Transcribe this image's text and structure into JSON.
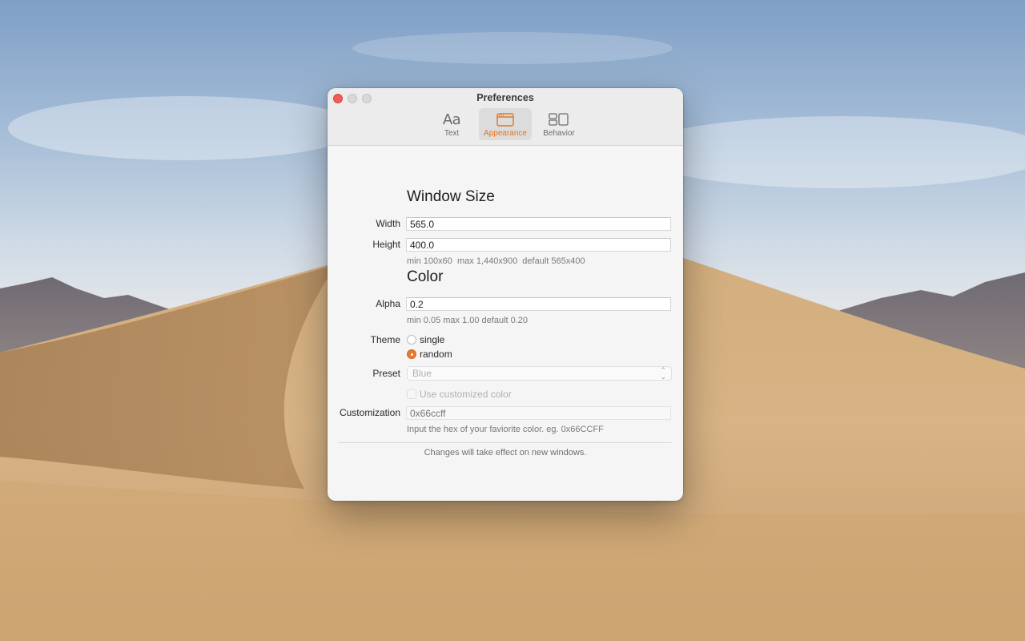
{
  "window": {
    "title": "Preferences"
  },
  "toolbar": {
    "items": [
      {
        "label": "Text",
        "icon": "text-format-icon",
        "glyph": "Aa",
        "active": false
      },
      {
        "label": "Appearance",
        "icon": "window-appearance-icon",
        "active": true
      },
      {
        "label": "Behavior",
        "icon": "layout-behavior-icon",
        "active": false
      }
    ]
  },
  "window_size": {
    "heading": "Window Size",
    "width_label": "Width",
    "width_value": "565.0",
    "height_label": "Height",
    "height_value": "400.0",
    "hint": "min 100x60  max 1,440x900  default 565x400"
  },
  "color": {
    "heading": "Color",
    "alpha_label": "Alpha",
    "alpha_value": "0.2",
    "alpha_hint": "min 0.05 max 1.00 default 0.20",
    "theme_label": "Theme",
    "theme_options": [
      {
        "label": "single",
        "selected": false
      },
      {
        "label": "random",
        "selected": true
      }
    ],
    "preset_label": "Preset",
    "preset_value": "Blue",
    "use_custom_label": "Use customized color",
    "customization_label": "Customization",
    "customization_placeholder": "0x66ccff",
    "customization_hint": "Input the hex of your faviorite color. eg. 0x66CCFF"
  },
  "footer": {
    "note": "Changes will take effect on new windows."
  },
  "colors": {
    "accent": "#e8792a",
    "close": "#ee5d56"
  }
}
